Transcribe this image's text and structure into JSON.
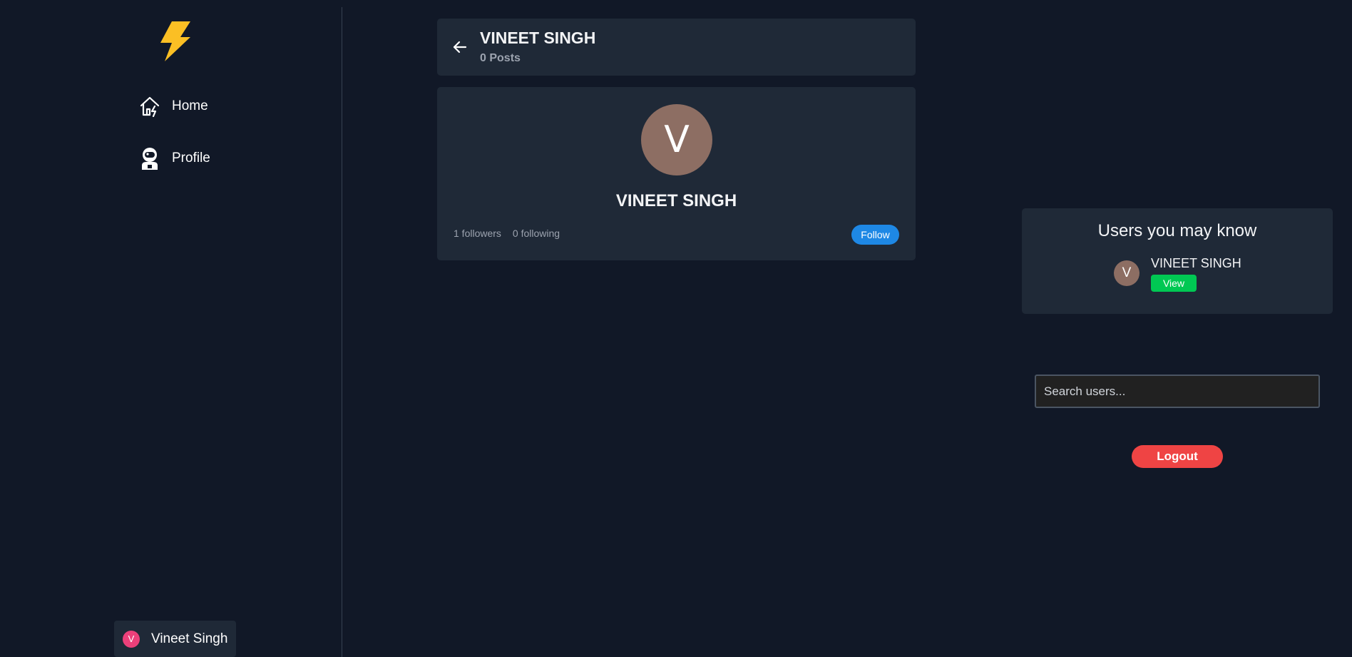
{
  "sidebar": {
    "logo_icon": "lightning-bolt-icon",
    "nav": {
      "home_label": "Home",
      "home_icon": "home-bolt-icon",
      "profile_label": "Profile",
      "profile_icon": "astronaut-icon"
    },
    "account": {
      "avatar_letter": "V",
      "name": "Vineet Singh"
    }
  },
  "header": {
    "back_icon": "arrow-left-icon",
    "name": "VINEET SINGH",
    "posts": "0 Posts"
  },
  "profile": {
    "avatar_letter": "V",
    "name": "VINEET SINGH",
    "followers": "1 followers",
    "following": "0 following",
    "follow_label": "Follow"
  },
  "suggestions": {
    "title": "Users you may know",
    "users": [
      {
        "avatar_letter": "V",
        "name": "VINEET SINGH",
        "view_label": "View"
      }
    ]
  },
  "search": {
    "placeholder": "Search users...",
    "value": ""
  },
  "logout_label": "Logout",
  "colors": {
    "background": "#111827",
    "card": "#1f2937",
    "follow": "#1e88e5",
    "view": "#00c853",
    "logout": "#ef4444",
    "logo": "#fbbf24",
    "avatar": "#8d6e63",
    "account_avatar": "#ec407a"
  }
}
